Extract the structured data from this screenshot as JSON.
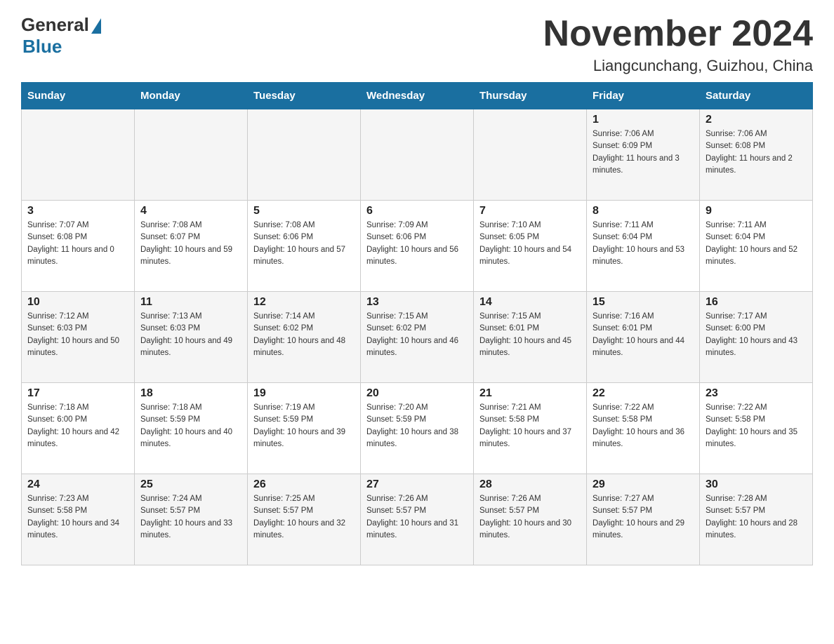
{
  "logo": {
    "general": "General",
    "blue": "Blue"
  },
  "title": "November 2024",
  "subtitle": "Liangcunchang, Guizhou, China",
  "days_of_week": [
    "Sunday",
    "Monday",
    "Tuesday",
    "Wednesday",
    "Thursday",
    "Friday",
    "Saturday"
  ],
  "weeks": [
    [
      null,
      null,
      null,
      null,
      null,
      {
        "day": "1",
        "sunrise": "Sunrise: 7:06 AM",
        "sunset": "Sunset: 6:09 PM",
        "daylight": "Daylight: 11 hours and 3 minutes."
      },
      {
        "day": "2",
        "sunrise": "Sunrise: 7:06 AM",
        "sunset": "Sunset: 6:08 PM",
        "daylight": "Daylight: 11 hours and 2 minutes."
      }
    ],
    [
      {
        "day": "3",
        "sunrise": "Sunrise: 7:07 AM",
        "sunset": "Sunset: 6:08 PM",
        "daylight": "Daylight: 11 hours and 0 minutes."
      },
      {
        "day": "4",
        "sunrise": "Sunrise: 7:08 AM",
        "sunset": "Sunset: 6:07 PM",
        "daylight": "Daylight: 10 hours and 59 minutes."
      },
      {
        "day": "5",
        "sunrise": "Sunrise: 7:08 AM",
        "sunset": "Sunset: 6:06 PM",
        "daylight": "Daylight: 10 hours and 57 minutes."
      },
      {
        "day": "6",
        "sunrise": "Sunrise: 7:09 AM",
        "sunset": "Sunset: 6:06 PM",
        "daylight": "Daylight: 10 hours and 56 minutes."
      },
      {
        "day": "7",
        "sunrise": "Sunrise: 7:10 AM",
        "sunset": "Sunset: 6:05 PM",
        "daylight": "Daylight: 10 hours and 54 minutes."
      },
      {
        "day": "8",
        "sunrise": "Sunrise: 7:11 AM",
        "sunset": "Sunset: 6:04 PM",
        "daylight": "Daylight: 10 hours and 53 minutes."
      },
      {
        "day": "9",
        "sunrise": "Sunrise: 7:11 AM",
        "sunset": "Sunset: 6:04 PM",
        "daylight": "Daylight: 10 hours and 52 minutes."
      }
    ],
    [
      {
        "day": "10",
        "sunrise": "Sunrise: 7:12 AM",
        "sunset": "Sunset: 6:03 PM",
        "daylight": "Daylight: 10 hours and 50 minutes."
      },
      {
        "day": "11",
        "sunrise": "Sunrise: 7:13 AM",
        "sunset": "Sunset: 6:03 PM",
        "daylight": "Daylight: 10 hours and 49 minutes."
      },
      {
        "day": "12",
        "sunrise": "Sunrise: 7:14 AM",
        "sunset": "Sunset: 6:02 PM",
        "daylight": "Daylight: 10 hours and 48 minutes."
      },
      {
        "day": "13",
        "sunrise": "Sunrise: 7:15 AM",
        "sunset": "Sunset: 6:02 PM",
        "daylight": "Daylight: 10 hours and 46 minutes."
      },
      {
        "day": "14",
        "sunrise": "Sunrise: 7:15 AM",
        "sunset": "Sunset: 6:01 PM",
        "daylight": "Daylight: 10 hours and 45 minutes."
      },
      {
        "day": "15",
        "sunrise": "Sunrise: 7:16 AM",
        "sunset": "Sunset: 6:01 PM",
        "daylight": "Daylight: 10 hours and 44 minutes."
      },
      {
        "day": "16",
        "sunrise": "Sunrise: 7:17 AM",
        "sunset": "Sunset: 6:00 PM",
        "daylight": "Daylight: 10 hours and 43 minutes."
      }
    ],
    [
      {
        "day": "17",
        "sunrise": "Sunrise: 7:18 AM",
        "sunset": "Sunset: 6:00 PM",
        "daylight": "Daylight: 10 hours and 42 minutes."
      },
      {
        "day": "18",
        "sunrise": "Sunrise: 7:18 AM",
        "sunset": "Sunset: 5:59 PM",
        "daylight": "Daylight: 10 hours and 40 minutes."
      },
      {
        "day": "19",
        "sunrise": "Sunrise: 7:19 AM",
        "sunset": "Sunset: 5:59 PM",
        "daylight": "Daylight: 10 hours and 39 minutes."
      },
      {
        "day": "20",
        "sunrise": "Sunrise: 7:20 AM",
        "sunset": "Sunset: 5:59 PM",
        "daylight": "Daylight: 10 hours and 38 minutes."
      },
      {
        "day": "21",
        "sunrise": "Sunrise: 7:21 AM",
        "sunset": "Sunset: 5:58 PM",
        "daylight": "Daylight: 10 hours and 37 minutes."
      },
      {
        "day": "22",
        "sunrise": "Sunrise: 7:22 AM",
        "sunset": "Sunset: 5:58 PM",
        "daylight": "Daylight: 10 hours and 36 minutes."
      },
      {
        "day": "23",
        "sunrise": "Sunrise: 7:22 AM",
        "sunset": "Sunset: 5:58 PM",
        "daylight": "Daylight: 10 hours and 35 minutes."
      }
    ],
    [
      {
        "day": "24",
        "sunrise": "Sunrise: 7:23 AM",
        "sunset": "Sunset: 5:58 PM",
        "daylight": "Daylight: 10 hours and 34 minutes."
      },
      {
        "day": "25",
        "sunrise": "Sunrise: 7:24 AM",
        "sunset": "Sunset: 5:57 PM",
        "daylight": "Daylight: 10 hours and 33 minutes."
      },
      {
        "day": "26",
        "sunrise": "Sunrise: 7:25 AM",
        "sunset": "Sunset: 5:57 PM",
        "daylight": "Daylight: 10 hours and 32 minutes."
      },
      {
        "day": "27",
        "sunrise": "Sunrise: 7:26 AM",
        "sunset": "Sunset: 5:57 PM",
        "daylight": "Daylight: 10 hours and 31 minutes."
      },
      {
        "day": "28",
        "sunrise": "Sunrise: 7:26 AM",
        "sunset": "Sunset: 5:57 PM",
        "daylight": "Daylight: 10 hours and 30 minutes."
      },
      {
        "day": "29",
        "sunrise": "Sunrise: 7:27 AM",
        "sunset": "Sunset: 5:57 PM",
        "daylight": "Daylight: 10 hours and 29 minutes."
      },
      {
        "day": "30",
        "sunrise": "Sunrise: 7:28 AM",
        "sunset": "Sunset: 5:57 PM",
        "daylight": "Daylight: 10 hours and 28 minutes."
      }
    ]
  ]
}
